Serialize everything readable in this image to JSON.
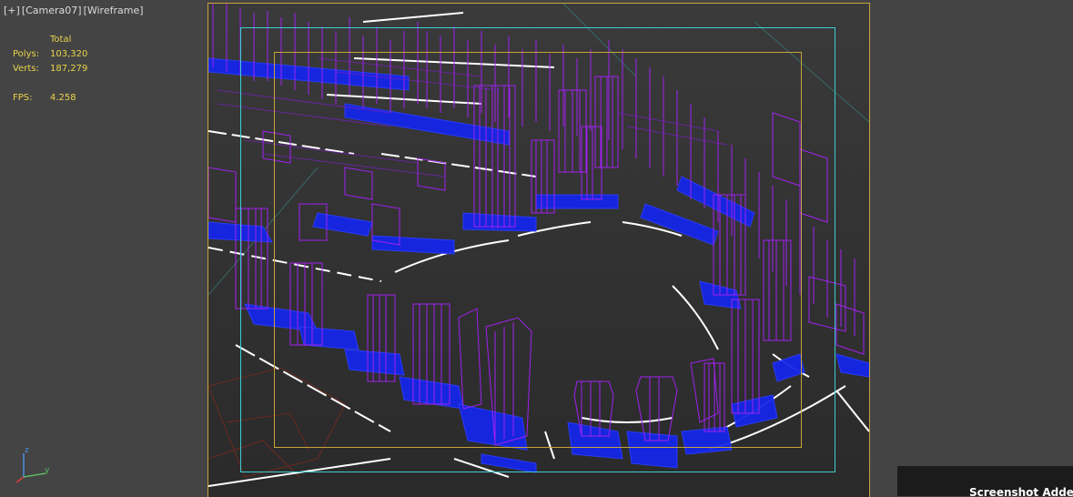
{
  "viewport": {
    "menu_label": "[+]",
    "camera_label": "[Camera07]",
    "shading_label": "[Wireframe]"
  },
  "stats": {
    "header": "Total",
    "polys_label": "Polys:",
    "polys_value": "103,320",
    "verts_label": "Verts:",
    "verts_value": "187,279",
    "fps_label": "FPS:",
    "fps_value": "4.258"
  },
  "axis": {
    "z_label": "z",
    "y_label": "y"
  },
  "notification": {
    "text": "Screenshot Adde"
  },
  "colors": {
    "buildings": "#a020f0",
    "bases": "#1a2cff",
    "roads": "#ffffff",
    "safe_frame": "#3ccfd2",
    "render_frame": "#c7a43a",
    "stats_text": "#e8d44a"
  }
}
